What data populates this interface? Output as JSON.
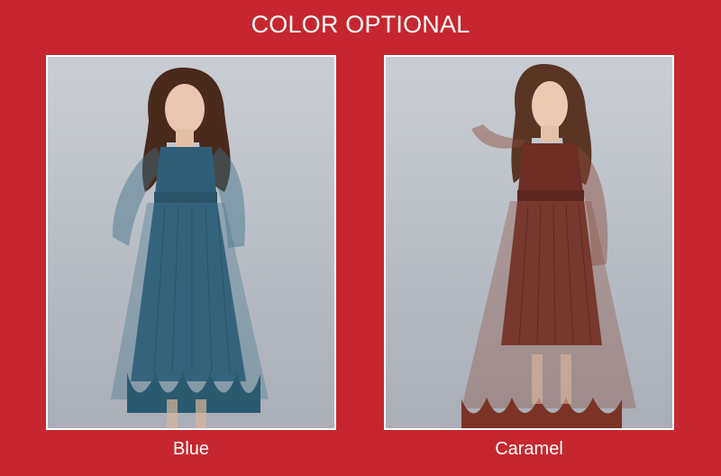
{
  "header": {
    "title": "COLOR OPTIONAL"
  },
  "products": [
    {
      "label": "Blue",
      "dress_color": "#2f5f78",
      "sheer_color": "#3e6f86",
      "ruffle_color": "#2a5a70"
    },
    {
      "label": "Caramel",
      "dress_color": "#6e2e25",
      "sheer_color": "#8a4a3c",
      "ruffle_color": "#7a3325"
    }
  ]
}
